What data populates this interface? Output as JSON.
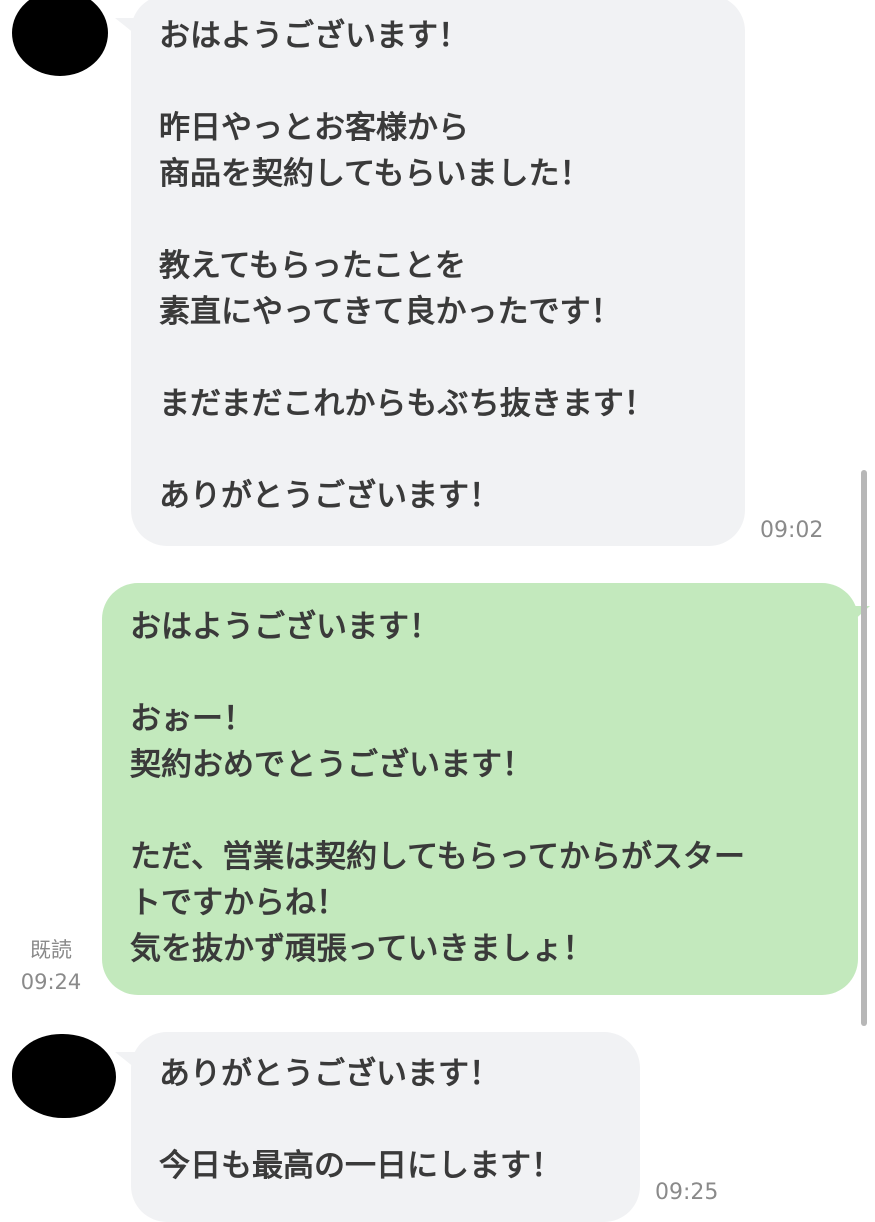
{
  "chat": {
    "messages": [
      {
        "direction": "incoming",
        "text": "おはようございます！\n\n昨日やっとお客様から\n商品を契約してもらいました！\n\n教えてもらったことを\n素直にやってきて良かったです！\n\nまだまだこれからもぶち抜きます！\n\nありがとうございます！",
        "time": "09:02"
      },
      {
        "direction": "outgoing",
        "text": "おはようございます！\n\nおぉー！\n契約おめでとうございます！\n\nただ、営業は契約してもらってからがスター\nトですからね！\n気を抜かず頑張っていきましょ！",
        "read_label": "既読",
        "time": "09:24"
      },
      {
        "direction": "incoming",
        "text": "ありがとうございます！\n\n今日も最高の一日にします！",
        "time": "09:25"
      }
    ]
  },
  "colors": {
    "incoming_bubble": "#f1f2f4",
    "outgoing_bubble": "#c3e9bd",
    "text": "#3a3a3a",
    "meta_text": "#8a8a8a"
  }
}
